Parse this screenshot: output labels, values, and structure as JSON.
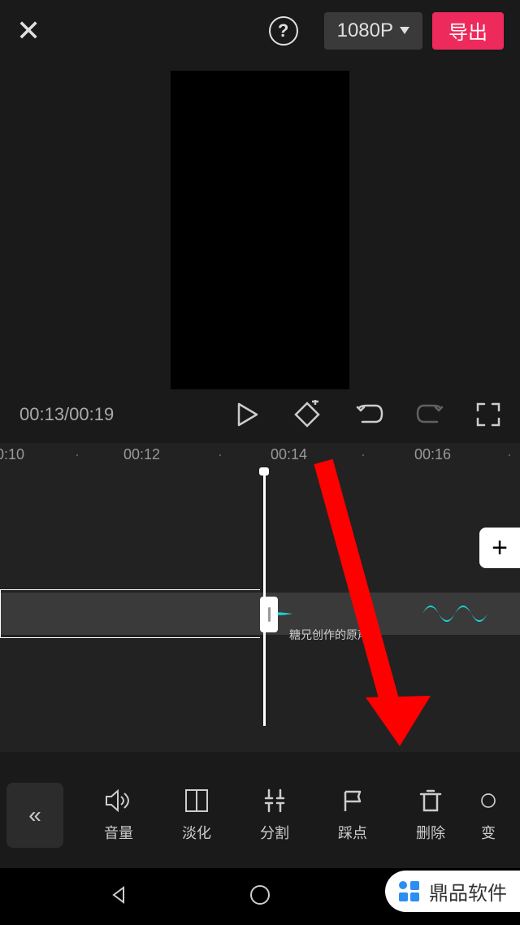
{
  "topbar": {
    "resolution": "1080P",
    "export_label": "导出"
  },
  "playback": {
    "timecode": "00:13/00:19"
  },
  "timeline": {
    "ruler_marks": [
      "0:10",
      "00:12",
      "00:14",
      "00:16"
    ],
    "clip_label": "糖兄创作的原声"
  },
  "toolbar": {
    "items": [
      {
        "label": "音量",
        "icon": "volume-icon"
      },
      {
        "label": "淡化",
        "icon": "fade-icon"
      },
      {
        "label": "分割",
        "icon": "split-icon"
      },
      {
        "label": "踩点",
        "icon": "beat-icon"
      },
      {
        "label": "删除",
        "icon": "delete-icon"
      },
      {
        "label": "变",
        "icon": "change-icon"
      }
    ]
  },
  "watermark": {
    "text": "鼎品软件"
  }
}
